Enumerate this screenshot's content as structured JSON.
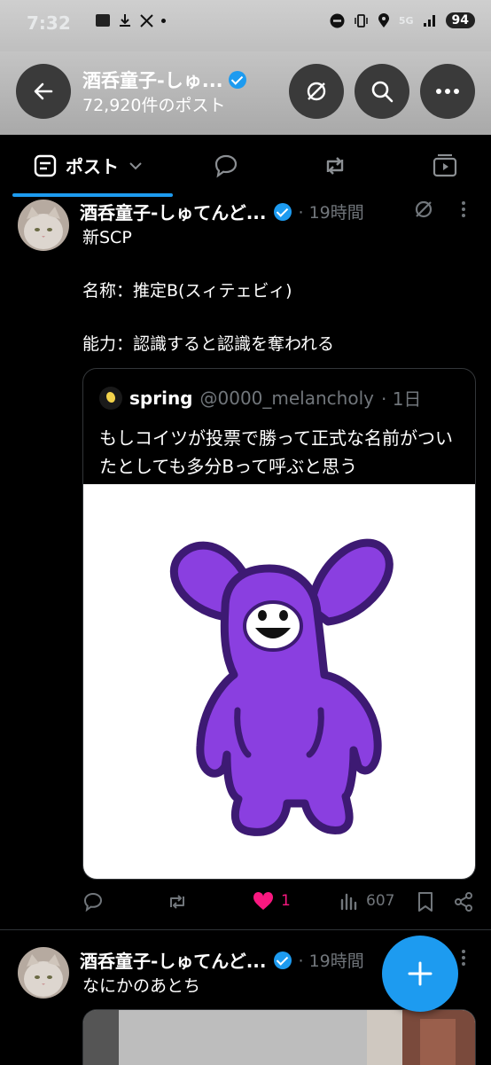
{
  "status_bar": {
    "time": "7:32",
    "network": "5G",
    "battery": "94",
    "icons": [
      "news-icon",
      "download-icon",
      "x-logo-icon",
      "dot-icon",
      "dnd-icon",
      "vibrate-icon",
      "location-icon",
      "signal-icon"
    ]
  },
  "header": {
    "title": "酒呑童子-しゅ...",
    "subtitle": "72,920件のポスト"
  },
  "tabs": {
    "active_label": "ポスト"
  },
  "tweets": [
    {
      "author": "酒呑童子-しゅてんど...",
      "time": "· 19時間",
      "text": "新SCP\n\n名称：推定B(スィテェビィ)\n\n能力：認識すると認識を奪われる",
      "quote": {
        "author": "spring",
        "handle": "@0000_melancholy",
        "time": "· 1日",
        "text": "もしコイツが投票で勝って正式な名前がついたとしても多分Bって呼ぶと思う"
      },
      "likes": "1",
      "views": "607"
    },
    {
      "author": "酒呑童子-しゅてんど...",
      "time": "· 19時間",
      "text": "なにかのあとち"
    }
  ],
  "colors": {
    "accent": "#1d9bf0",
    "like": "#f91880",
    "creature": "#8a3fe0",
    "muted": "#71767b"
  }
}
